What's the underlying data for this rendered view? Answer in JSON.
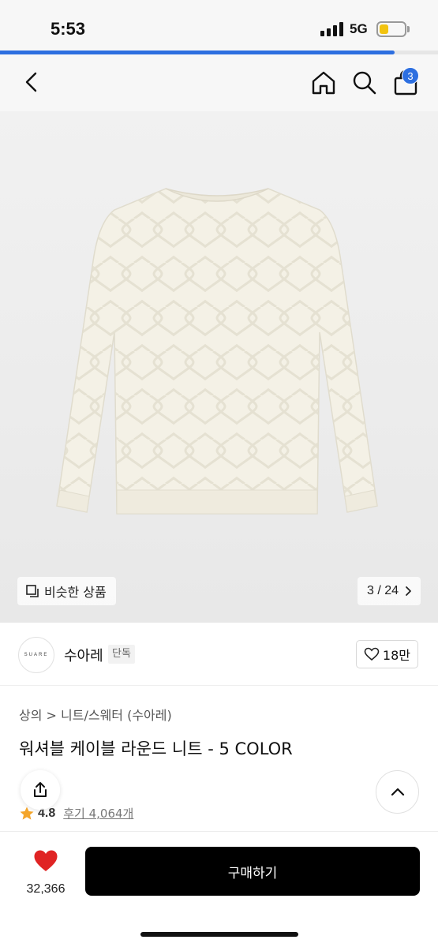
{
  "status_bar": {
    "time": "5:53",
    "network": "5G",
    "battery_level": 0.35,
    "page_load_progress": 0.9
  },
  "header": {
    "back_icon": "chevron-left-icon",
    "home_icon": "home-icon",
    "search_icon": "search-icon",
    "cart_icon": "shopping-bag-icon",
    "cart_badge": "3",
    "accent_color": "#2d6fe0"
  },
  "gallery": {
    "similar_label": "비슷한 상품",
    "page_indicator": "3 / 24",
    "image_subject": "cream cable-knit sweater",
    "sweater_color": "#f4f1e6"
  },
  "brand": {
    "logo_text": "SUARE",
    "name": "수아레",
    "tag": "단독",
    "like_count": "18만"
  },
  "product": {
    "breadcrumb": "상의 > 니트/스웨터 (수아레)",
    "title": "워셔블 케이블 라운드 니트 - 5 COLOR",
    "rating": "4.8",
    "review_label": "후기 4,064개",
    "star_color": "#f4a52a"
  },
  "bottom_bar": {
    "wish_count": "32,366",
    "heart_color": "#e02424",
    "buy_label": "구매하기"
  }
}
